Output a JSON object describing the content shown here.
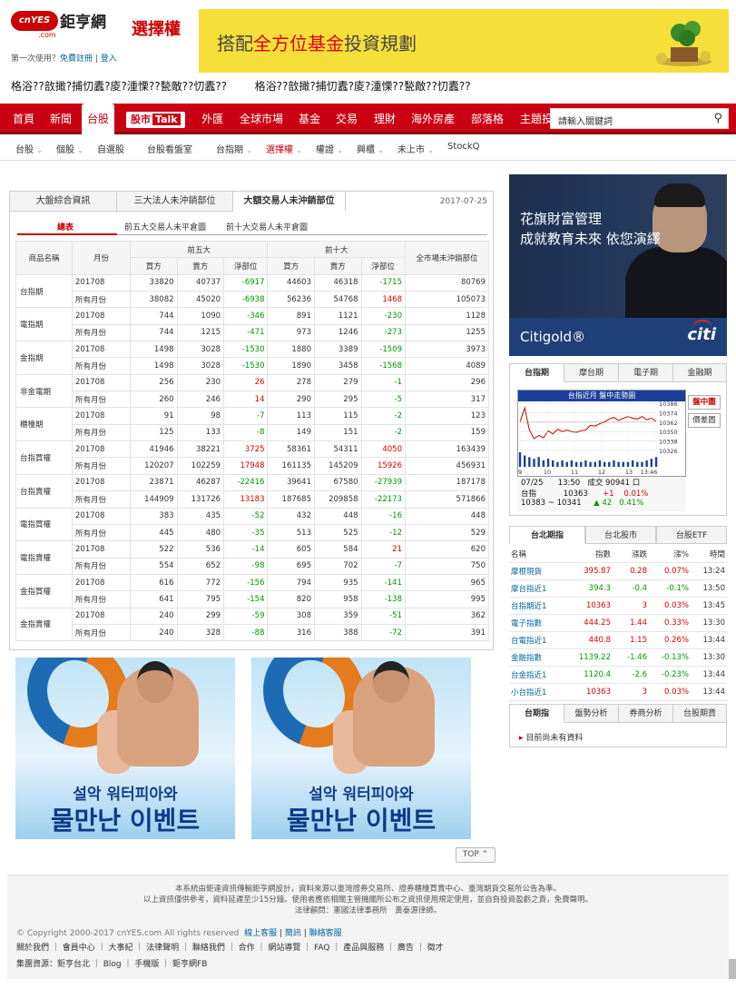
{
  "header": {
    "logo_text": "cnYES",
    "logo_cn": "鉅亨網",
    "logo_sub": ".com",
    "section_title": "選擇權",
    "login_prompt": "第一次使用？",
    "register": "免費註冊",
    "login": "登入",
    "banner_pre": "搭配",
    "banner_hl": "全方位基金",
    "banner_post": "投資規劃",
    "ticker_1": "格浴??敨撖?捕忉蠹?庱?湩慄??甃敵??忉蠹??",
    "ticker_2": "格浴??敨撖?捕忉蠹?庱?湩慄??甃敵??忉蠹??"
  },
  "nav": {
    "items": [
      "首頁",
      "新聞",
      "台股",
      "股市Talk",
      "外匯",
      "全球市場",
      "基金",
      "交易",
      "理財",
      "海外房產",
      "部落格",
      "主題投"
    ],
    "talk_a": "股市",
    "talk_b": "Talk",
    "search_placeholder": "請輸入關鍵詞"
  },
  "subnav": [
    "台股",
    "個股",
    "自選股",
    "台股看盤室",
    "台指期",
    "選擇權",
    "權證",
    "興櫃",
    "未上市",
    "StockQ"
  ],
  "main": {
    "tabs": [
      "大盤綜合資訊",
      "三大法人未沖銷部位",
      "大額交易人未沖銷部位"
    ],
    "date": "2017-07-25",
    "subtabs": [
      "總表",
      "前五大交易人未平倉圖",
      "前十大交易人未平倉圖"
    ],
    "headers": {
      "name": "商品名稱",
      "month": "月份",
      "top5": "前五大",
      "top10": "前十大",
      "buy": "買方",
      "sell": "賣方",
      "net": "淨部位",
      "market": "全市場未沖銷部位"
    },
    "rows": [
      {
        "name": "台指期",
        "r1": [
          "201708",
          "33820",
          "40737",
          "-6917",
          "44603",
          "46318",
          "-1715",
          "80769"
        ],
        "r2": [
          "所有月份",
          "38082",
          "45020",
          "-6938",
          "56236",
          "54768",
          "1468",
          "105073"
        ]
      },
      {
        "name": "電指期",
        "r1": [
          "201708",
          "744",
          "1090",
          "-346",
          "891",
          "1121",
          "-230",
          "1128"
        ],
        "r2": [
          "所有月份",
          "744",
          "1215",
          "-471",
          "973",
          "1246",
          "-273",
          "1255"
        ]
      },
      {
        "name": "金指期",
        "r1": [
          "201708",
          "1498",
          "3028",
          "-1530",
          "1880",
          "3389",
          "-1509",
          "3973"
        ],
        "r2": [
          "所有月份",
          "1498",
          "3028",
          "-1530",
          "1890",
          "3458",
          "-1568",
          "4089"
        ]
      },
      {
        "name": "非金電期",
        "r1": [
          "201708",
          "256",
          "230",
          "26",
          "278",
          "279",
          "-1",
          "296"
        ],
        "r2": [
          "所有月份",
          "260",
          "246",
          "14",
          "290",
          "295",
          "-5",
          "317"
        ]
      },
      {
        "name": "櫃檯期",
        "r1": [
          "201708",
          "91",
          "98",
          "-7",
          "113",
          "115",
          "-2",
          "123"
        ],
        "r2": [
          "所有月份",
          "125",
          "133",
          "-8",
          "149",
          "151",
          "-2",
          "159"
        ]
      },
      {
        "name": "台指買權",
        "r1": [
          "201708",
          "41946",
          "38221",
          "3725",
          "58361",
          "54311",
          "4050",
          "163439"
        ],
        "r2": [
          "所有月份",
          "120207",
          "102259",
          "17948",
          "161135",
          "145209",
          "15926",
          "456931"
        ]
      },
      {
        "name": "台指賣權",
        "r1": [
          "201708",
          "23871",
          "46287",
          "-22416",
          "39641",
          "67580",
          "-27939",
          "187178"
        ],
        "r2": [
          "所有月份",
          "144909",
          "131726",
          "13183",
          "187685",
          "209858",
          "-22173",
          "571866"
        ]
      },
      {
        "name": "電指買權",
        "r1": [
          "201708",
          "383",
          "435",
          "-52",
          "432",
          "448",
          "-16",
          "448"
        ],
        "r2": [
          "所有月份",
          "445",
          "480",
          "-35",
          "513",
          "525",
          "-12",
          "529"
        ]
      },
      {
        "name": "電指賣權",
        "r1": [
          "201708",
          "522",
          "536",
          "-14",
          "605",
          "584",
          "21",
          "620"
        ],
        "r2": [
          "所有月份",
          "554",
          "652",
          "-98",
          "695",
          "702",
          "-7",
          "750"
        ]
      },
      {
        "name": "金指買權",
        "r1": [
          "201708",
          "616",
          "772",
          "-156",
          "794",
          "935",
          "-141",
          "965"
        ],
        "r2": [
          "所有月份",
          "641",
          "795",
          "-154",
          "820",
          "958",
          "-138",
          "995"
        ]
      },
      {
        "name": "金指賣權",
        "r1": [
          "201708",
          "240",
          "299",
          "-59",
          "308",
          "359",
          "-51",
          "362"
        ],
        "r2": [
          "所有月份",
          "240",
          "328",
          "-88",
          "316",
          "388",
          "-72",
          "391"
        ]
      }
    ]
  },
  "ads": {
    "kr_line1": "설악 워터피아와",
    "kr_line2": "물만난 이벤트",
    "top_button": "TOP"
  },
  "citi": {
    "line1": "花旗財富管理",
    "line2": "成就教育未來 依您演繹",
    "brand": "Citigold",
    "logo": "citi"
  },
  "futures": {
    "tabs": [
      "台指期",
      "摩台期",
      "電子期",
      "金融期"
    ],
    "chart_title": "台指近月 盤中走勢圖",
    "btn_intraday": "盤中圖",
    "btn_history": "價差圖",
    "quote_date": "07/25",
    "quote_time": "13:50",
    "quote_volume": "成交 90941 口",
    "quote_name": "台指",
    "quote_price": "10363",
    "quote_change": "+1",
    "quote_pct": "0.01%",
    "quote_range": "10383 ~ 10341",
    "quote_delta": "▲ 42",
    "quote_delta_pct": "0.41%"
  },
  "chart_data": {
    "type": "line",
    "title": "台指近月 盤中走勢圖",
    "x_ticks": [
      "9",
      "10",
      "11",
      "12",
      "13",
      "13:46"
    ],
    "y_ticks": [
      "10386",
      "10374",
      "10362",
      "10350",
      "10338",
      "10326"
    ],
    "ylim": [
      10326,
      10386
    ],
    "reference": 10362,
    "series": [
      {
        "values": [
          10362,
          10380,
          10352,
          10341,
          10345,
          10342,
          10351,
          10347,
          10353,
          10350,
          10352,
          10350,
          10349,
          10351,
          10352,
          10358,
          10357,
          10360,
          10362,
          10366,
          10368,
          10364,
          10367,
          10369,
          10367,
          10366,
          10369,
          10365,
          10367,
          10363
        ]
      }
    ],
    "volume": [
      9,
      7,
      6,
      5,
      6,
      4,
      5,
      4,
      3,
      4,
      3,
      4,
      3,
      3,
      4,
      3,
      3,
      4,
      3,
      3,
      4,
      3,
      3,
      3,
      4,
      3,
      3,
      4,
      5,
      6
    ]
  },
  "tw_index": {
    "tabs": [
      "台北期指",
      "台北股市",
      "台股ETF"
    ],
    "headers": [
      "名稱",
      "指數",
      "漲跌",
      "漲%",
      "時間"
    ],
    "rows": [
      [
        "摩根現貨",
        "395.87",
        "0.28",
        "0.07%",
        "13:24"
      ],
      [
        "摩台指近1",
        "394.3",
        "-0.4",
        "-0.1%",
        "13:50"
      ],
      [
        "台指期近1",
        "10363",
        "3",
        "0.03%",
        "13:45"
      ],
      [
        "電子指數",
        "444.25",
        "1.44",
        "0.33%",
        "13:30"
      ],
      [
        "台電指近1",
        "440.8",
        "1.15",
        "0.26%",
        "13:44"
      ],
      [
        "金融指數",
        "1139.22",
        "-1.46",
        "-0.13%",
        "13:30"
      ],
      [
        "台金指近1",
        "1120.4",
        "-2.6",
        "-0.23%",
        "13:44"
      ],
      [
        "小台指近1",
        "10363",
        "3",
        "0.03%",
        "13:44"
      ]
    ]
  },
  "rank": {
    "tabs": [
      "台期指",
      "盤勢分析",
      "券商分析",
      "台股期貨"
    ],
    "message": "目前尚未有資料"
  },
  "footer": {
    "disc1": "本系統由鉅達資訊傳輸鉅亨網設計，資料來源以臺灣證券交易所、證券櫃檯買賣中心、臺灣期貨交易所公告為準。",
    "disc2": "以上資訊僅供參考，資料延遲至少15分鐘。使用者應依相關主管機關所公布之資訊使用規定使用，並自負投資盈虧之責，免費聲明。",
    "disc3": "法律顧問：憲國法律事務所　黃泰源律師。",
    "copyright": "© Copyright 2000-2017 cnYES.com All rights reserved",
    "cs": "線上客服",
    "jobs": "簡訊",
    "contact": "聯絡客服",
    "links": "關於我們 ｜ 會員中心 ｜ 大事紀 ｜ 法律聲明 ｜ 聯絡我們 ｜ 合作 ｜ 網站導覽 ｜ FAQ ｜ 產品與服務 ｜ 廣告 ｜ 徵才",
    "group": "集團資源：鉅亨台北 ｜ Blog ｜ 手機版 ｜ 鉅亨網FB"
  }
}
